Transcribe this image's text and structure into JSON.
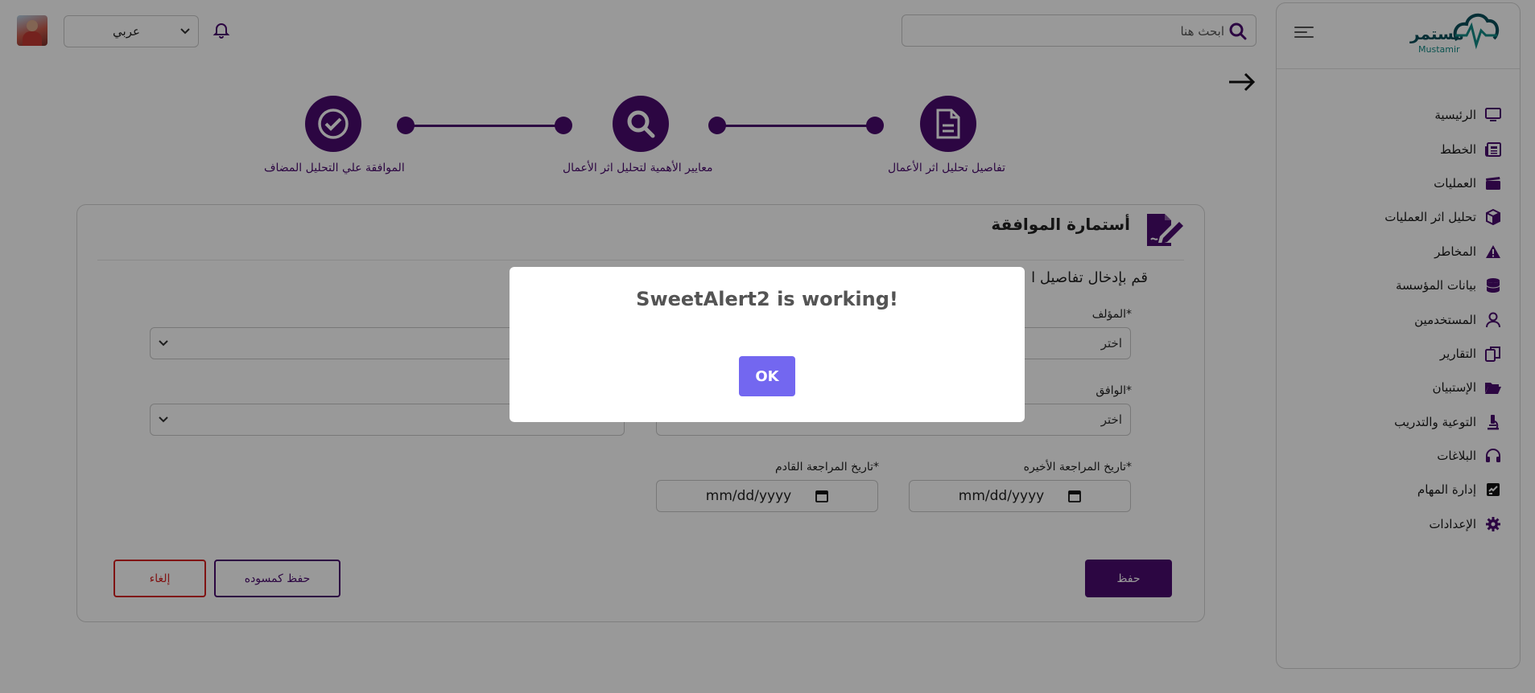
{
  "header": {
    "language_value": "عربي",
    "search_placeholder": "ابحث هنا"
  },
  "logo": {
    "arabic": "مستمر",
    "english": "Mustamir"
  },
  "sidebar": {
    "items": [
      {
        "label": "الرئيسية",
        "icon": "monitor-icon"
      },
      {
        "label": "الخطط",
        "icon": "newspaper-icon"
      },
      {
        "label": "العمليات",
        "icon": "clapperboard-icon"
      },
      {
        "label": "تحليل اثر العمليات",
        "icon": "cube-icon"
      },
      {
        "label": "المخاطر",
        "icon": "warning-icon"
      },
      {
        "label": "بيانات المؤسسة",
        "icon": "database-icon"
      },
      {
        "label": "المستخدمين",
        "icon": "user-icon"
      },
      {
        "label": "التقارير",
        "icon": "copy-icon"
      },
      {
        "label": "الإستبيان",
        "icon": "folder-open-icon"
      },
      {
        "label": "التوعية والتدريب",
        "icon": "microscope-icon"
      },
      {
        "label": "البلاغات",
        "icon": "headphones-icon"
      },
      {
        "label": "إدارة المهام",
        "icon": "task-icon"
      },
      {
        "label": "الإعدادات",
        "icon": "gear-icon"
      }
    ]
  },
  "stepper": {
    "steps": [
      {
        "label": "تفاصيل تحليل اثر الأعمال",
        "icon": "document-icon"
      },
      {
        "label": "معايير الأهمية لتحليل اثر الأعمال",
        "icon": "search-icon"
      },
      {
        "label": "الموافقة علي التحليل المضاف",
        "icon": "check-circle-icon"
      }
    ]
  },
  "form": {
    "title": "أستمارة الموافقة",
    "subtitle": "قم بإدخال تفاصيل ا",
    "author_label": "*المؤلف",
    "author_value": "اختر",
    "approver_label": "*الوافق",
    "approver_value": "اختر",
    "last_review_label": "*تاريخ المراجعة الأخيره",
    "last_review_value": "mm/dd/yyyy",
    "next_review_label": "*تاريخ المراجعة القادم",
    "next_review_value": "mm/dd/yyyy",
    "save_label": "حفظ",
    "draft_label": "حفظ كمسوده",
    "cancel_label": "إلغاء"
  },
  "modal": {
    "title": "SweetAlert2 is working!",
    "ok_label": "OK"
  },
  "colors": {
    "primary": "#4a0a6e",
    "danger": "#d62020",
    "modal_button": "#7367f0"
  }
}
